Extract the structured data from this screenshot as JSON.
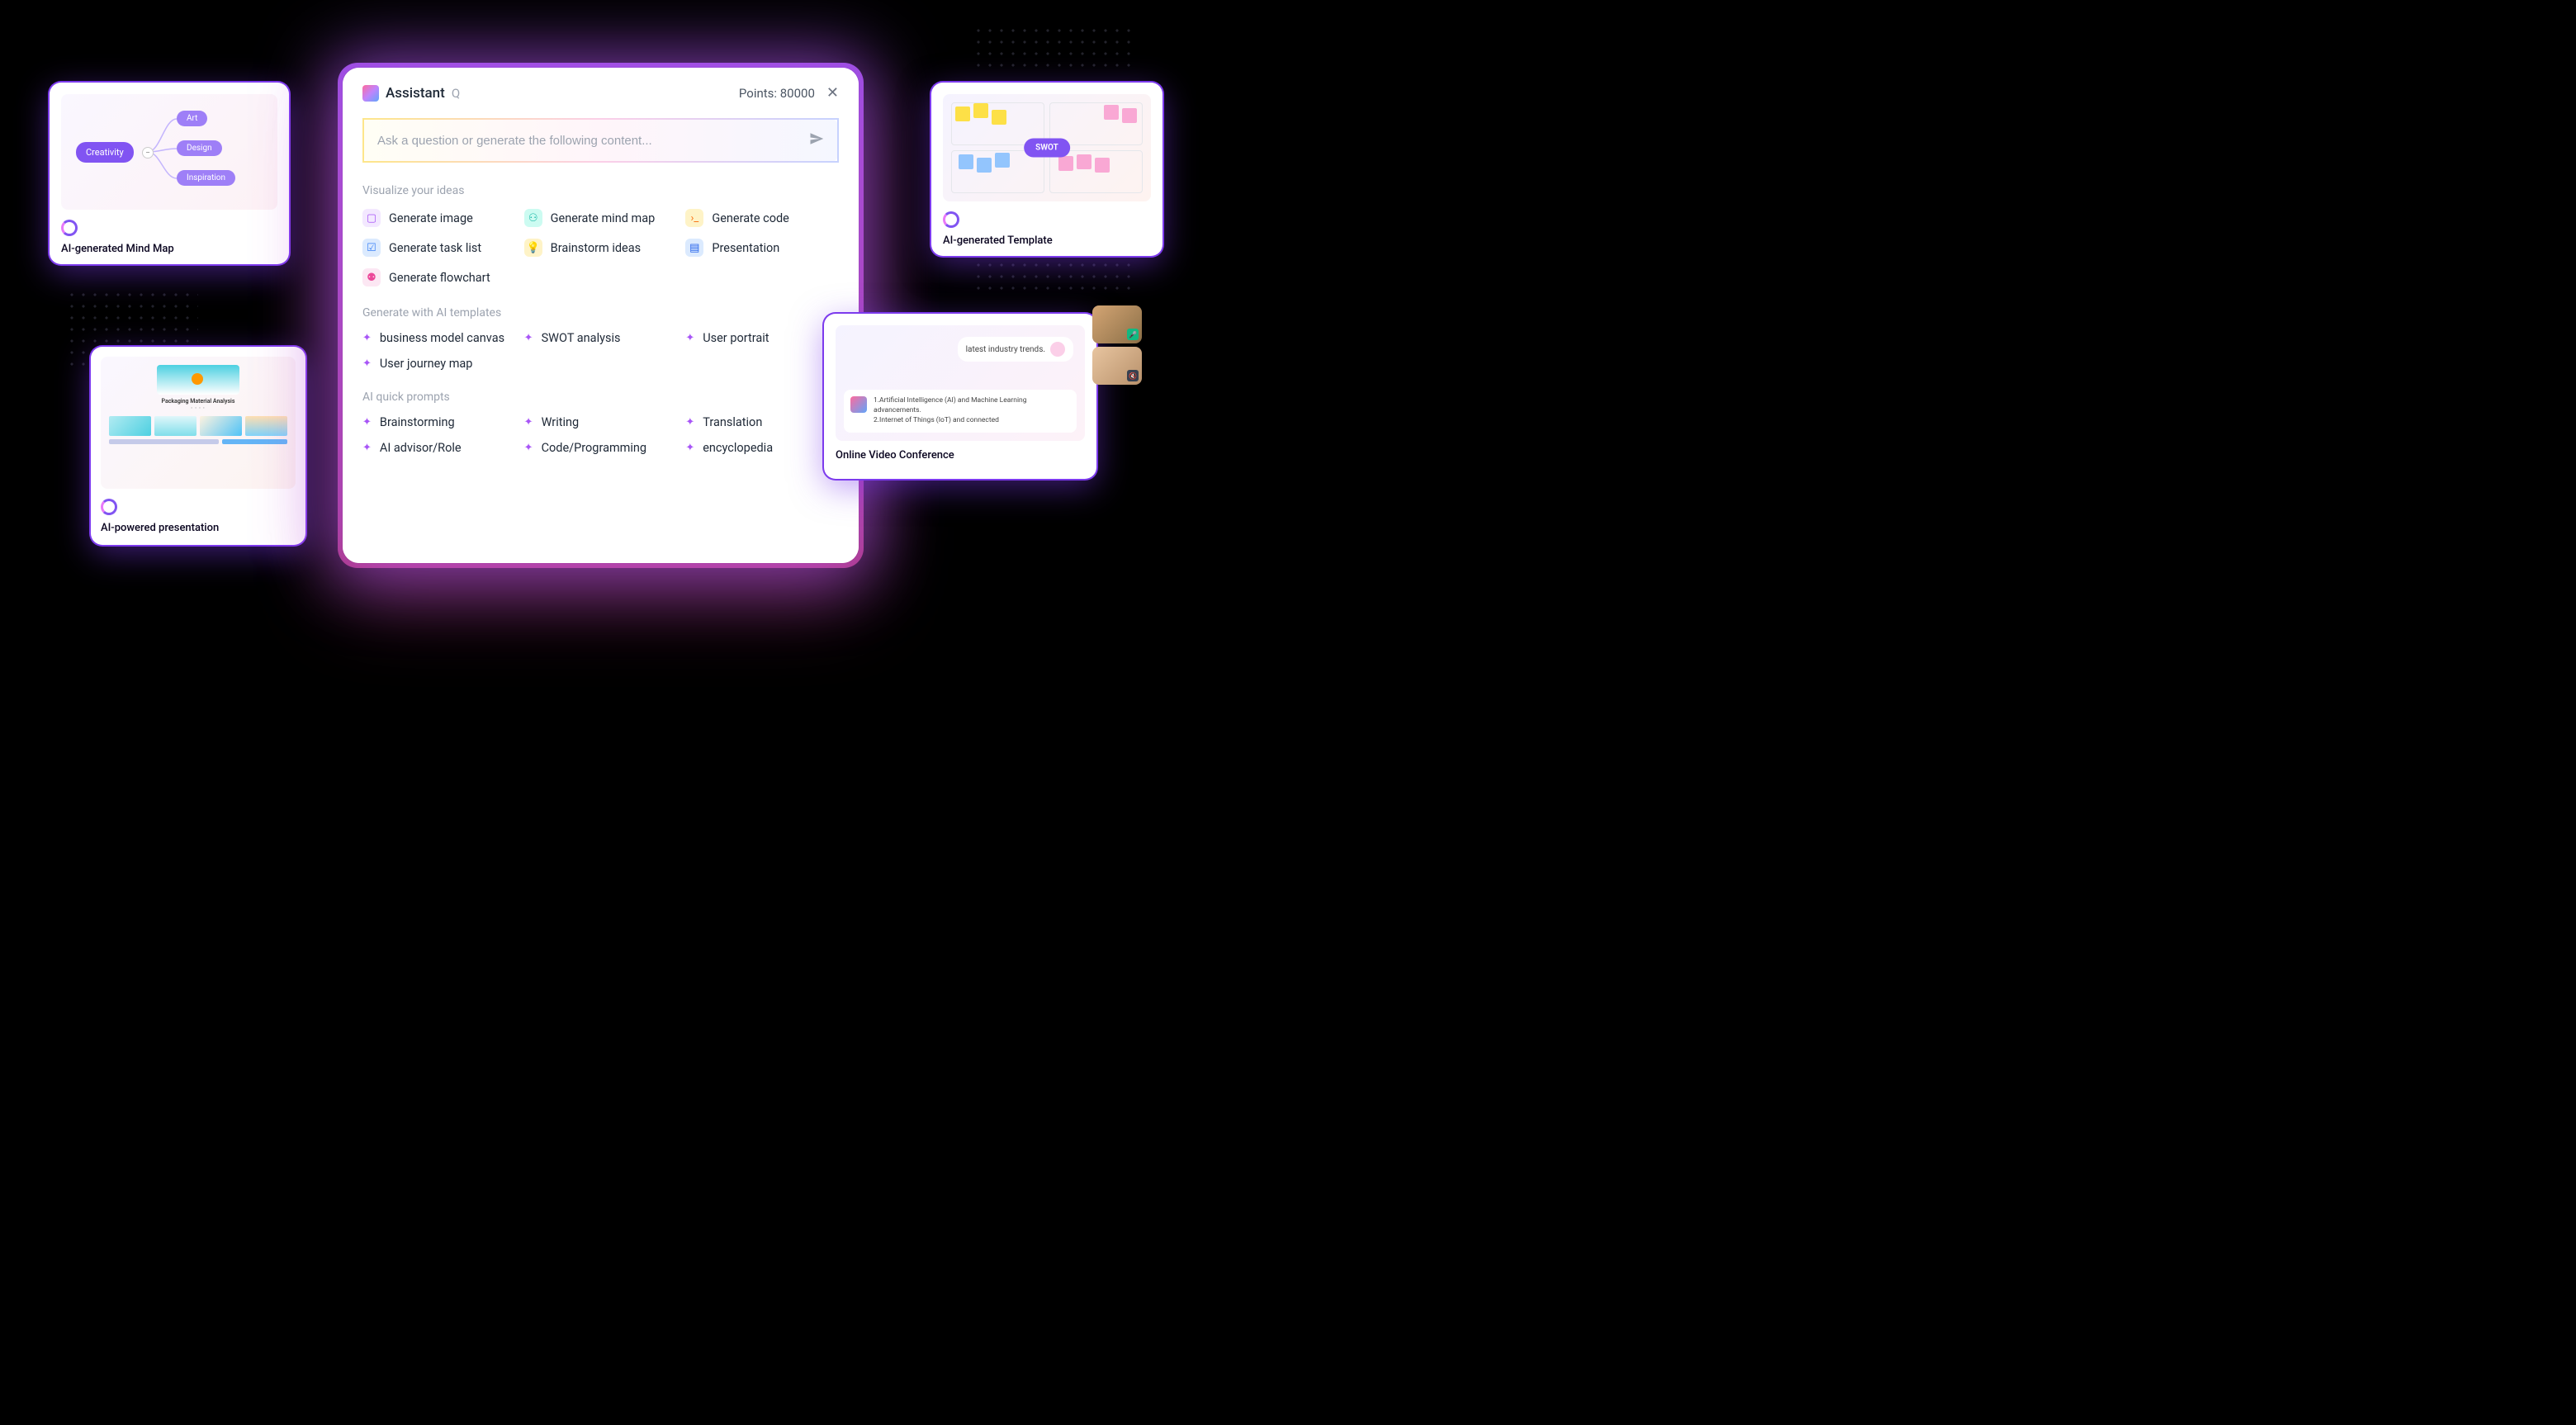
{
  "mindmap_card": {
    "root": "Creativity",
    "children": [
      "Art",
      "Design",
      "Inspiration"
    ],
    "caption": "AI-generated Mind Map"
  },
  "presentation_card": {
    "slide_title": "Packaging Material Analysis",
    "caption": "AI-powered presentation"
  },
  "main": {
    "title": "Assistant",
    "q": "Q",
    "points_label": "Points: 80000",
    "close": "✕",
    "search_placeholder": "Ask a question or generate the following content...",
    "section1_label": "Visualize your ideas",
    "opts1": {
      "image": "Generate image",
      "mindmap": "Generate mind map",
      "code": "Generate code",
      "task": "Generate task list",
      "brainstorm": "Brainstorm ideas",
      "presentation": "Presentation",
      "flowchart": "Generate flowchart"
    },
    "section2_label": "Generate with AI templates",
    "opts2": {
      "bmc": "business model canvas",
      "swot": "SWOT analysis",
      "portrait": "User portrait",
      "journey": "User journey map"
    },
    "section3_label": "AI quick prompts",
    "opts3": {
      "brainstorm": "Brainstorming",
      "writing": "Writing",
      "translation": "Translation",
      "advisor": "AI advisor/Role",
      "code": "Code/Programming",
      "encyclopedia": "encyclopedia"
    }
  },
  "template_card": {
    "badge": "SWOT",
    "caption": "AI-generated Template"
  },
  "video_card": {
    "bubble": "latest industry trends.",
    "doc_line1": "1.Artificial Intelligence (AI) and Machine Learning advancements.",
    "doc_line2": "2.Internet of Things (IoT) and connected",
    "caption": "Online Video Conference"
  }
}
